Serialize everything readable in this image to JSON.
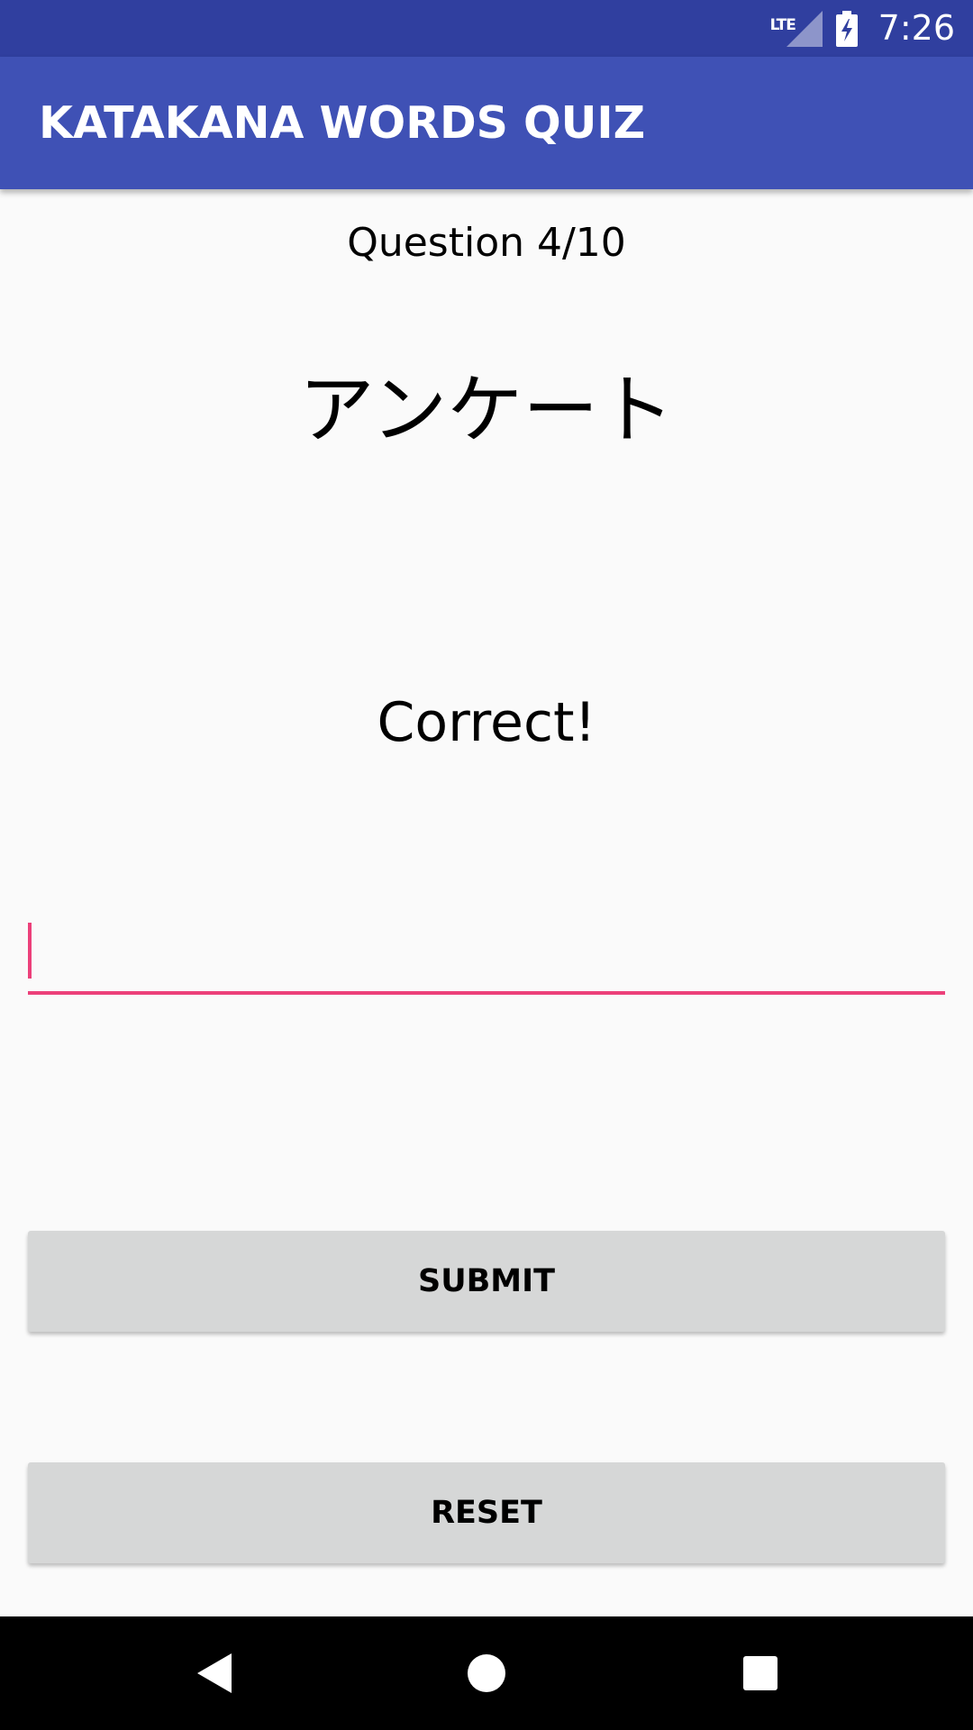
{
  "status_bar": {
    "network_type": "LTE",
    "time": "7:26",
    "signal_icon": "cell-signal-icon",
    "battery_icon": "battery-charging-icon"
  },
  "app_bar": {
    "title": "KATAKANA WORDS QUIZ"
  },
  "quiz": {
    "question_counter": "Question 4/10",
    "katakana_word": "アンケート",
    "feedback": "Correct!"
  },
  "answer_input": {
    "value": "",
    "placeholder": ""
  },
  "buttons": {
    "submit_label": "SUBMIT",
    "reset_label": "RESET"
  },
  "nav_bar": {
    "back_icon": "back-triangle-icon",
    "home_icon": "home-circle-icon",
    "recents_icon": "recents-square-icon"
  },
  "colors": {
    "status_bar": "#303f9f",
    "app_bar": "#3f51b5",
    "accent": "#ec407a",
    "button_bg": "#d6d7d7",
    "background": "#fafafa"
  }
}
